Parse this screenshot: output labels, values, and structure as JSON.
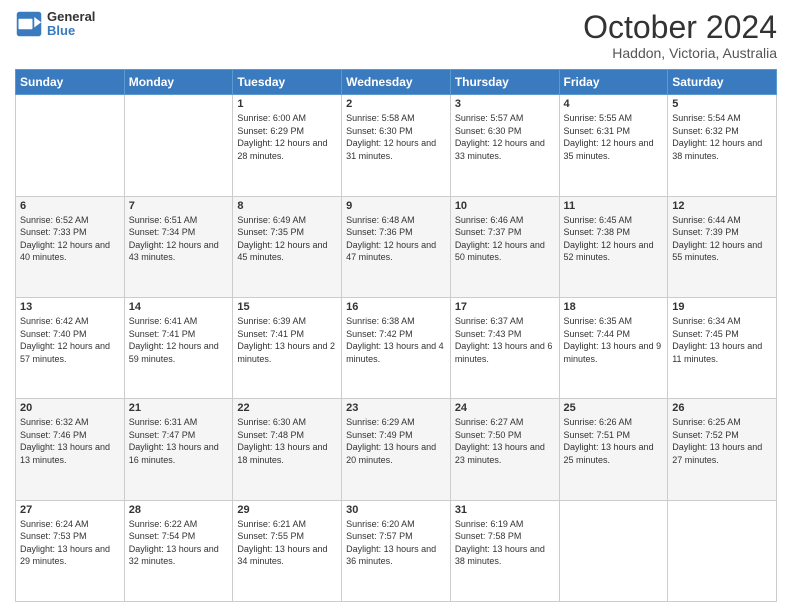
{
  "header": {
    "logo_general": "General",
    "logo_blue": "Blue",
    "month_title": "October 2024",
    "location": "Haddon, Victoria, Australia"
  },
  "days_of_week": [
    "Sunday",
    "Monday",
    "Tuesday",
    "Wednesday",
    "Thursday",
    "Friday",
    "Saturday"
  ],
  "weeks": [
    [
      {
        "day": "",
        "sunrise": "",
        "sunset": "",
        "daylight": ""
      },
      {
        "day": "",
        "sunrise": "",
        "sunset": "",
        "daylight": ""
      },
      {
        "day": "1",
        "sunrise": "Sunrise: 6:00 AM",
        "sunset": "Sunset: 6:29 PM",
        "daylight": "Daylight: 12 hours and 28 minutes."
      },
      {
        "day": "2",
        "sunrise": "Sunrise: 5:58 AM",
        "sunset": "Sunset: 6:30 PM",
        "daylight": "Daylight: 12 hours and 31 minutes."
      },
      {
        "day": "3",
        "sunrise": "Sunrise: 5:57 AM",
        "sunset": "Sunset: 6:30 PM",
        "daylight": "Daylight: 12 hours and 33 minutes."
      },
      {
        "day": "4",
        "sunrise": "Sunrise: 5:55 AM",
        "sunset": "Sunset: 6:31 PM",
        "daylight": "Daylight: 12 hours and 35 minutes."
      },
      {
        "day": "5",
        "sunrise": "Sunrise: 5:54 AM",
        "sunset": "Sunset: 6:32 PM",
        "daylight": "Daylight: 12 hours and 38 minutes."
      }
    ],
    [
      {
        "day": "6",
        "sunrise": "Sunrise: 6:52 AM",
        "sunset": "Sunset: 7:33 PM",
        "daylight": "Daylight: 12 hours and 40 minutes."
      },
      {
        "day": "7",
        "sunrise": "Sunrise: 6:51 AM",
        "sunset": "Sunset: 7:34 PM",
        "daylight": "Daylight: 12 hours and 43 minutes."
      },
      {
        "day": "8",
        "sunrise": "Sunrise: 6:49 AM",
        "sunset": "Sunset: 7:35 PM",
        "daylight": "Daylight: 12 hours and 45 minutes."
      },
      {
        "day": "9",
        "sunrise": "Sunrise: 6:48 AM",
        "sunset": "Sunset: 7:36 PM",
        "daylight": "Daylight: 12 hours and 47 minutes."
      },
      {
        "day": "10",
        "sunrise": "Sunrise: 6:46 AM",
        "sunset": "Sunset: 7:37 PM",
        "daylight": "Daylight: 12 hours and 50 minutes."
      },
      {
        "day": "11",
        "sunrise": "Sunrise: 6:45 AM",
        "sunset": "Sunset: 7:38 PM",
        "daylight": "Daylight: 12 hours and 52 minutes."
      },
      {
        "day": "12",
        "sunrise": "Sunrise: 6:44 AM",
        "sunset": "Sunset: 7:39 PM",
        "daylight": "Daylight: 12 hours and 55 minutes."
      }
    ],
    [
      {
        "day": "13",
        "sunrise": "Sunrise: 6:42 AM",
        "sunset": "Sunset: 7:40 PM",
        "daylight": "Daylight: 12 hours and 57 minutes."
      },
      {
        "day": "14",
        "sunrise": "Sunrise: 6:41 AM",
        "sunset": "Sunset: 7:41 PM",
        "daylight": "Daylight: 12 hours and 59 minutes."
      },
      {
        "day": "15",
        "sunrise": "Sunrise: 6:39 AM",
        "sunset": "Sunset: 7:41 PM",
        "daylight": "Daylight: 13 hours and 2 minutes."
      },
      {
        "day": "16",
        "sunrise": "Sunrise: 6:38 AM",
        "sunset": "Sunset: 7:42 PM",
        "daylight": "Daylight: 13 hours and 4 minutes."
      },
      {
        "day": "17",
        "sunrise": "Sunrise: 6:37 AM",
        "sunset": "Sunset: 7:43 PM",
        "daylight": "Daylight: 13 hours and 6 minutes."
      },
      {
        "day": "18",
        "sunrise": "Sunrise: 6:35 AM",
        "sunset": "Sunset: 7:44 PM",
        "daylight": "Daylight: 13 hours and 9 minutes."
      },
      {
        "day": "19",
        "sunrise": "Sunrise: 6:34 AM",
        "sunset": "Sunset: 7:45 PM",
        "daylight": "Daylight: 13 hours and 11 minutes."
      }
    ],
    [
      {
        "day": "20",
        "sunrise": "Sunrise: 6:32 AM",
        "sunset": "Sunset: 7:46 PM",
        "daylight": "Daylight: 13 hours and 13 minutes."
      },
      {
        "day": "21",
        "sunrise": "Sunrise: 6:31 AM",
        "sunset": "Sunset: 7:47 PM",
        "daylight": "Daylight: 13 hours and 16 minutes."
      },
      {
        "day": "22",
        "sunrise": "Sunrise: 6:30 AM",
        "sunset": "Sunset: 7:48 PM",
        "daylight": "Daylight: 13 hours and 18 minutes."
      },
      {
        "day": "23",
        "sunrise": "Sunrise: 6:29 AM",
        "sunset": "Sunset: 7:49 PM",
        "daylight": "Daylight: 13 hours and 20 minutes."
      },
      {
        "day": "24",
        "sunrise": "Sunrise: 6:27 AM",
        "sunset": "Sunset: 7:50 PM",
        "daylight": "Daylight: 13 hours and 23 minutes."
      },
      {
        "day": "25",
        "sunrise": "Sunrise: 6:26 AM",
        "sunset": "Sunset: 7:51 PM",
        "daylight": "Daylight: 13 hours and 25 minutes."
      },
      {
        "day": "26",
        "sunrise": "Sunrise: 6:25 AM",
        "sunset": "Sunset: 7:52 PM",
        "daylight": "Daylight: 13 hours and 27 minutes."
      }
    ],
    [
      {
        "day": "27",
        "sunrise": "Sunrise: 6:24 AM",
        "sunset": "Sunset: 7:53 PM",
        "daylight": "Daylight: 13 hours and 29 minutes."
      },
      {
        "day": "28",
        "sunrise": "Sunrise: 6:22 AM",
        "sunset": "Sunset: 7:54 PM",
        "daylight": "Daylight: 13 hours and 32 minutes."
      },
      {
        "day": "29",
        "sunrise": "Sunrise: 6:21 AM",
        "sunset": "Sunset: 7:55 PM",
        "daylight": "Daylight: 13 hours and 34 minutes."
      },
      {
        "day": "30",
        "sunrise": "Sunrise: 6:20 AM",
        "sunset": "Sunset: 7:57 PM",
        "daylight": "Daylight: 13 hours and 36 minutes."
      },
      {
        "day": "31",
        "sunrise": "Sunrise: 6:19 AM",
        "sunset": "Sunset: 7:58 PM",
        "daylight": "Daylight: 13 hours and 38 minutes."
      },
      {
        "day": "",
        "sunrise": "",
        "sunset": "",
        "daylight": ""
      },
      {
        "day": "",
        "sunrise": "",
        "sunset": "",
        "daylight": ""
      }
    ]
  ]
}
